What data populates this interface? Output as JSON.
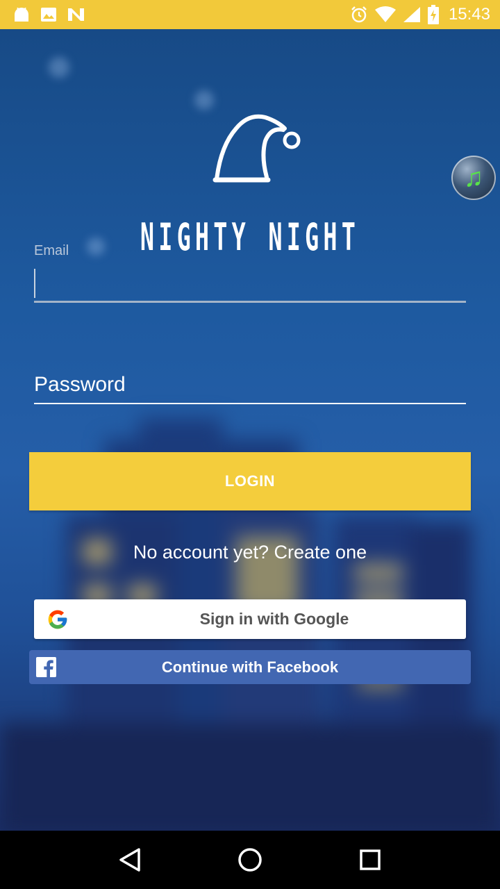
{
  "status_bar": {
    "time": "15:43",
    "left_icons": [
      "android-icon",
      "image-icon",
      "n-notification-icon"
    ],
    "right_icons": [
      "alarm-icon",
      "wifi-icon",
      "signal-icon",
      "battery-icon"
    ],
    "background": "#f2c93a"
  },
  "app": {
    "title": "NIGHTY NIGHT",
    "music_icon": "music-note-icon"
  },
  "form": {
    "email_label": "Email",
    "email_value": "",
    "password_placeholder": "Password",
    "login_label": "LOGIN",
    "create_account": "No account yet? Create one"
  },
  "social": {
    "google_label": "Sign in with Google",
    "facebook_label": "Continue with Facebook"
  },
  "colors": {
    "accent": "#f4cd3c",
    "facebook": "#4267b2",
    "background_top": "#174a86"
  },
  "nav": {
    "icons": [
      "back-icon",
      "home-icon",
      "recents-icon"
    ]
  }
}
